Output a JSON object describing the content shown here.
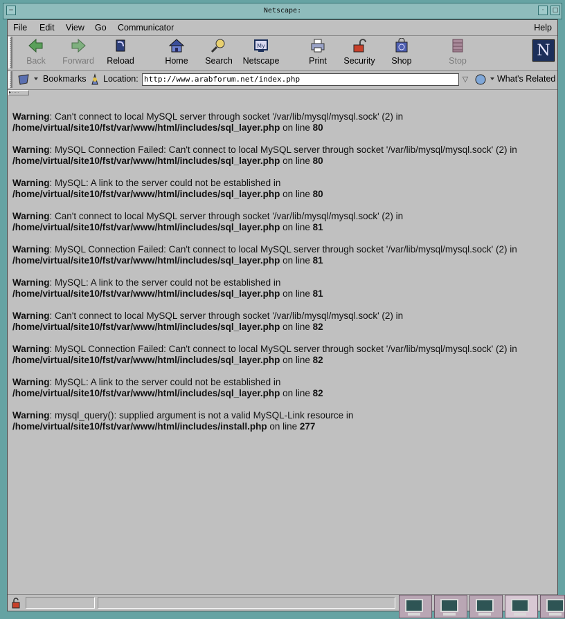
{
  "window": {
    "title": "Netscape:"
  },
  "menu": {
    "items": [
      "File",
      "Edit",
      "View",
      "Go",
      "Communicator"
    ],
    "help": "Help"
  },
  "toolbar": {
    "buttons": [
      {
        "label": "Back",
        "icon": "back-arrow-icon",
        "enabled": false
      },
      {
        "label": "Forward",
        "icon": "forward-arrow-icon",
        "enabled": false
      },
      {
        "label": "Reload",
        "icon": "reload-icon",
        "enabled": true
      },
      {
        "label": "Home",
        "icon": "home-icon",
        "enabled": true
      },
      {
        "label": "Search",
        "icon": "search-icon",
        "enabled": true
      },
      {
        "label": "Netscape",
        "icon": "netscape-icon",
        "enabled": true
      },
      {
        "label": "Print",
        "icon": "printer-icon",
        "enabled": true
      },
      {
        "label": "Security",
        "icon": "padlock-icon",
        "enabled": true
      },
      {
        "label": "Shop",
        "icon": "shop-icon",
        "enabled": true
      },
      {
        "label": "Stop",
        "icon": "stop-icon",
        "enabled": false
      }
    ],
    "logo_letter": "N"
  },
  "location": {
    "bookmarks_label": "Bookmarks",
    "location_label": "Location:",
    "url": "http://www.arabforum.net/index.php",
    "whats_related": "What's Related"
  },
  "warnings": [
    {
      "label": "Warning",
      "message": ": Can't connect to local MySQL server through socket '/var/lib/mysql/mysql.sock' (2) in",
      "path": "/home/virtual/site10/fst/var/www/html/includes/sql_layer.php",
      "online": " on line ",
      "line": "80"
    },
    {
      "label": "Warning",
      "message": ": MySQL Connection Failed: Can't connect to local MySQL server through socket '/var/lib/mysql/mysql.sock' (2) in",
      "path": "/home/virtual/site10/fst/var/www/html/includes/sql_layer.php",
      "online": " on line ",
      "line": "80"
    },
    {
      "label": "Warning",
      "message": ": MySQL: A link to the server could not be established in",
      "path": "/home/virtual/site10/fst/var/www/html/includes/sql_layer.php",
      "online": " on line ",
      "line": "80"
    },
    {
      "label": "Warning",
      "message": ": Can't connect to local MySQL server through socket '/var/lib/mysql/mysql.sock' (2) in",
      "path": "/home/virtual/site10/fst/var/www/html/includes/sql_layer.php",
      "online": " on line ",
      "line": "81"
    },
    {
      "label": "Warning",
      "message": ": MySQL Connection Failed: Can't connect to local MySQL server through socket '/var/lib/mysql/mysql.sock' (2) in",
      "path": "/home/virtual/site10/fst/var/www/html/includes/sql_layer.php",
      "online": " on line ",
      "line": "81"
    },
    {
      "label": "Warning",
      "message": ": MySQL: A link to the server could not be established in",
      "path": "/home/virtual/site10/fst/var/www/html/includes/sql_layer.php",
      "online": " on line ",
      "line": "81"
    },
    {
      "label": "Warning",
      "message": ": Can't connect to local MySQL server through socket '/var/lib/mysql/mysql.sock' (2) in",
      "path": "/home/virtual/site10/fst/var/www/html/includes/sql_layer.php",
      "online": " on line ",
      "line": "82"
    },
    {
      "label": "Warning",
      "message": ": MySQL Connection Failed: Can't connect to local MySQL server through socket '/var/lib/mysql/mysql.sock' (2) in",
      "path": "/home/virtual/site10/fst/var/www/html/includes/sql_layer.php",
      "online": " on line ",
      "line": "82"
    },
    {
      "label": "Warning",
      "message": ": MySQL: A link to the server could not be established in",
      "path": "/home/virtual/site10/fst/var/www/html/includes/sql_layer.php",
      "online": " on line ",
      "line": "82"
    },
    {
      "label": "Warning",
      "message": ": mysql_query(): supplied argument is not a valid MySQL-Link resource in",
      "path": "/home/virtual/site10/fst/var/www/html/includes/install.php",
      "online": " on line ",
      "line": "277"
    }
  ],
  "colors": {
    "desktop": "#5f9ea0",
    "chrome": "#c0c0c0",
    "text": "#111111"
  }
}
